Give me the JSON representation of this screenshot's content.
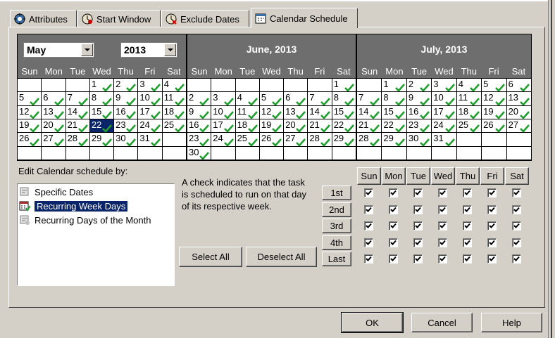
{
  "tabs": [
    {
      "label": "Attributes",
      "icon": "attributes-icon"
    },
    {
      "label": "Start Window",
      "icon": "start-window-icon"
    },
    {
      "label": "Exclude Dates",
      "icon": "exclude-dates-icon"
    },
    {
      "label": "Calendar Schedule",
      "icon": "calendar-icon"
    }
  ],
  "month_select": "May",
  "year_select": "2013",
  "months": [
    {
      "title": "",
      "first_dow": 3,
      "days": 31,
      "selected": 22
    },
    {
      "title": "June, 2013",
      "first_dow": 6,
      "days": 30,
      "selected": null
    },
    {
      "title": "July, 2013",
      "first_dow": 1,
      "days": 31,
      "selected": null
    }
  ],
  "dow": [
    "Sun",
    "Mon",
    "Tue",
    "Wed",
    "Thu",
    "Fri",
    "Sat"
  ],
  "edit_label": "Edit Calendar schedule by:",
  "list_items": [
    {
      "label": "Specific Dates",
      "icon": "specific-dates-icon",
      "selected": false
    },
    {
      "label": "Recurring Week Days",
      "icon": "recurring-week-days-icon",
      "selected": true
    },
    {
      "label": "Recurring Days of the Month",
      "icon": "recurring-month-days-icon",
      "selected": false
    }
  ],
  "info_lines": [
    "A check indicates that the task",
    "is scheduled to run on that day",
    "of its respective week."
  ],
  "select_all": "Select All",
  "deselect_all": "Deselect All",
  "weeks": [
    "1st",
    "2nd",
    "3rd",
    "4th",
    "Last"
  ],
  "week_checks": [
    [
      true,
      true,
      true,
      true,
      true,
      true,
      true
    ],
    [
      true,
      true,
      true,
      true,
      true,
      true,
      true
    ],
    [
      true,
      true,
      true,
      true,
      true,
      true,
      true
    ],
    [
      true,
      true,
      true,
      true,
      true,
      true,
      true
    ],
    [
      true,
      true,
      true,
      true,
      true,
      true,
      true
    ]
  ],
  "ok": "OK",
  "cancel": "Cancel",
  "help": "Help",
  "colors": {
    "header_gray": "#6e6e6e",
    "selection": "#0a246a",
    "check_green": "#1f9f2e",
    "dialog": "#d4d0c8"
  }
}
